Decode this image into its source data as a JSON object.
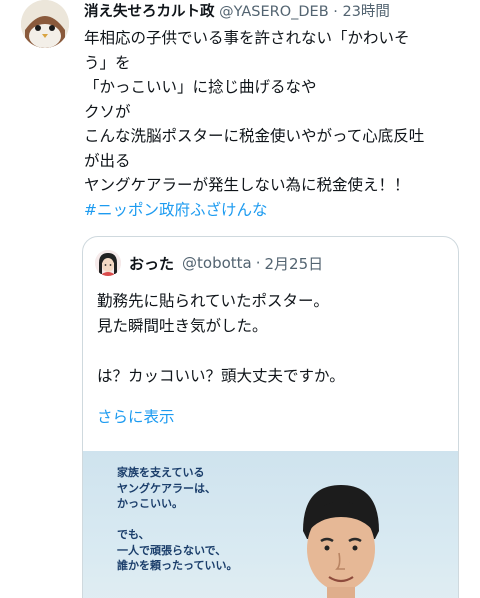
{
  "tweet": {
    "display_name": "消え失せろカルト政",
    "handle": "@YASERO_DEB",
    "separator": "·",
    "time": "23時間",
    "lines": [
      "年相応の子供でいる事を許されない「かわいそ",
      "う」を",
      "「かっこいい」に捻じ曲げるなや",
      "クソが",
      "こんな洗脳ポスターに税金使いやがって心底反吐",
      "が出る",
      "ヤングケアラーが発生しない為に税金使え！！"
    ],
    "hashtag": "#ニッポン政府ふざけんな"
  },
  "quote": {
    "display_name": "おった",
    "handle": "@tobotta",
    "separator": "·",
    "date": "2月25日",
    "lines": [
      "勤務先に貼られていたポスター。",
      "見た瞬間吐き気がした。",
      "",
      "は？カッコいい？頭大丈夫ですか。"
    ],
    "show_more": "さらに表示",
    "poster_lines": [
      "家族を支えている",
      "ヤングケアラーは、",
      "かっこいい。",
      "",
      "でも、",
      "一人で頑張らないで、",
      "誰かを頼ったっていい。"
    ]
  },
  "colors": {
    "link": "#1d9bf0",
    "secondary_text": "#536471",
    "border": "#cfd9de"
  }
}
